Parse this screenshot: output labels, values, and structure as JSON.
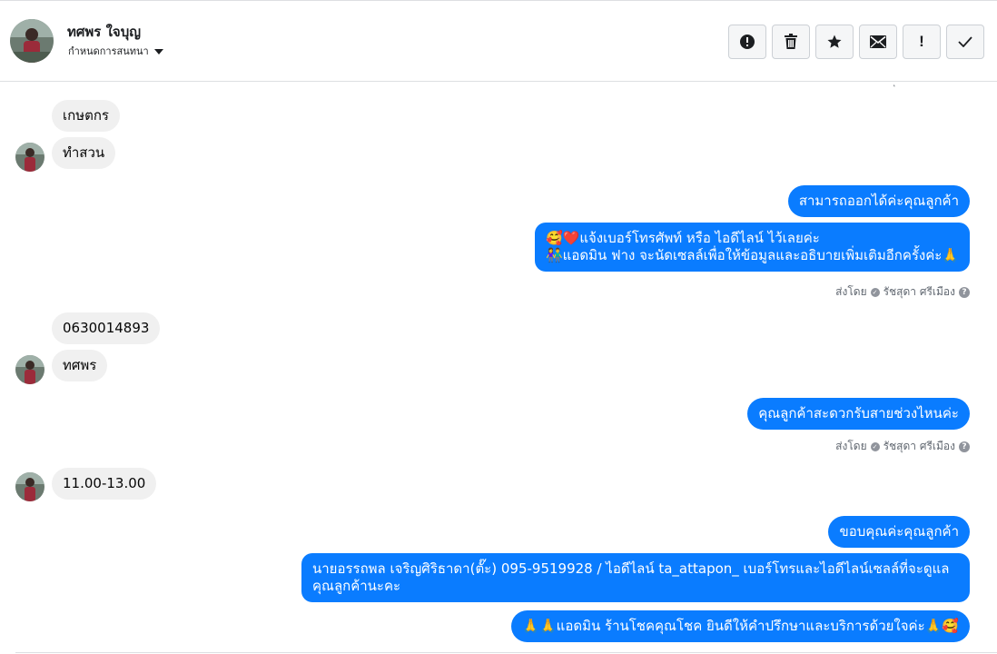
{
  "header": {
    "contact_name": "ทศพร ใจบุญ",
    "assign_label": "กำหนดการสนทนา"
  },
  "actions": [
    {
      "name": "report-spam-button",
      "icon": "alert-circle-icon"
    },
    {
      "name": "delete-button",
      "icon": "trash-icon"
    },
    {
      "name": "star-button",
      "icon": "star-icon"
    },
    {
      "name": "mark-unread-button",
      "icon": "envelope-icon"
    },
    {
      "name": "follow-up-button",
      "icon": "exclamation-icon",
      "text": "!"
    },
    {
      "name": "mark-done-button",
      "icon": "checkmark-icon"
    }
  ],
  "messages": {
    "in_1": "เกษตกร",
    "in_2": "ทำสวน",
    "out_1": "สามารถออกได้ค่ะคุณลูกค้า",
    "out_2_line1": "🥰❤️แจ้งเบอร์โทรศัพท์ หรือ ไอดีไลน์  ไว้เลยค่ะ",
    "out_2_line2": "👫แอดมิน ฟาง จะนัดเซลล์เพื่อให้ข้อมูลและอธิบายเพิ่มเติมอีกครั้งค่ะ🙏",
    "in_3": "0630014893",
    "in_4": "ทศพร",
    "out_3": "คุณลูกค้าสะดวกรับสายช่วงไหนค่ะ",
    "in_5": "11.00-13.00",
    "out_4": "ขอบคุณค่ะคุณลูกค้า",
    "out_5": "นายอรรถพล เจริญศิริธาดา(ตั๊ะ)      095-9519928 / ไอดีไลน์ ta_attapon_   เบอร์โทรและไอดีไลน์เซลล์ที่จะดูแลคุณลูกค้านะคะ",
    "out_6": "🙏🙏แอดมิน ร้านโชคคุณโชค ยินดีให้คำปรึกษาและบริการด้วยใจค่ะ🙏🥰"
  },
  "sent_by": {
    "label": "ส่งโดย",
    "agent": "รัชสุดา ศรีเมือง",
    "help": "?"
  },
  "colors": {
    "outgoing": "#0a7cff",
    "incoming": "#f0f0f0"
  }
}
